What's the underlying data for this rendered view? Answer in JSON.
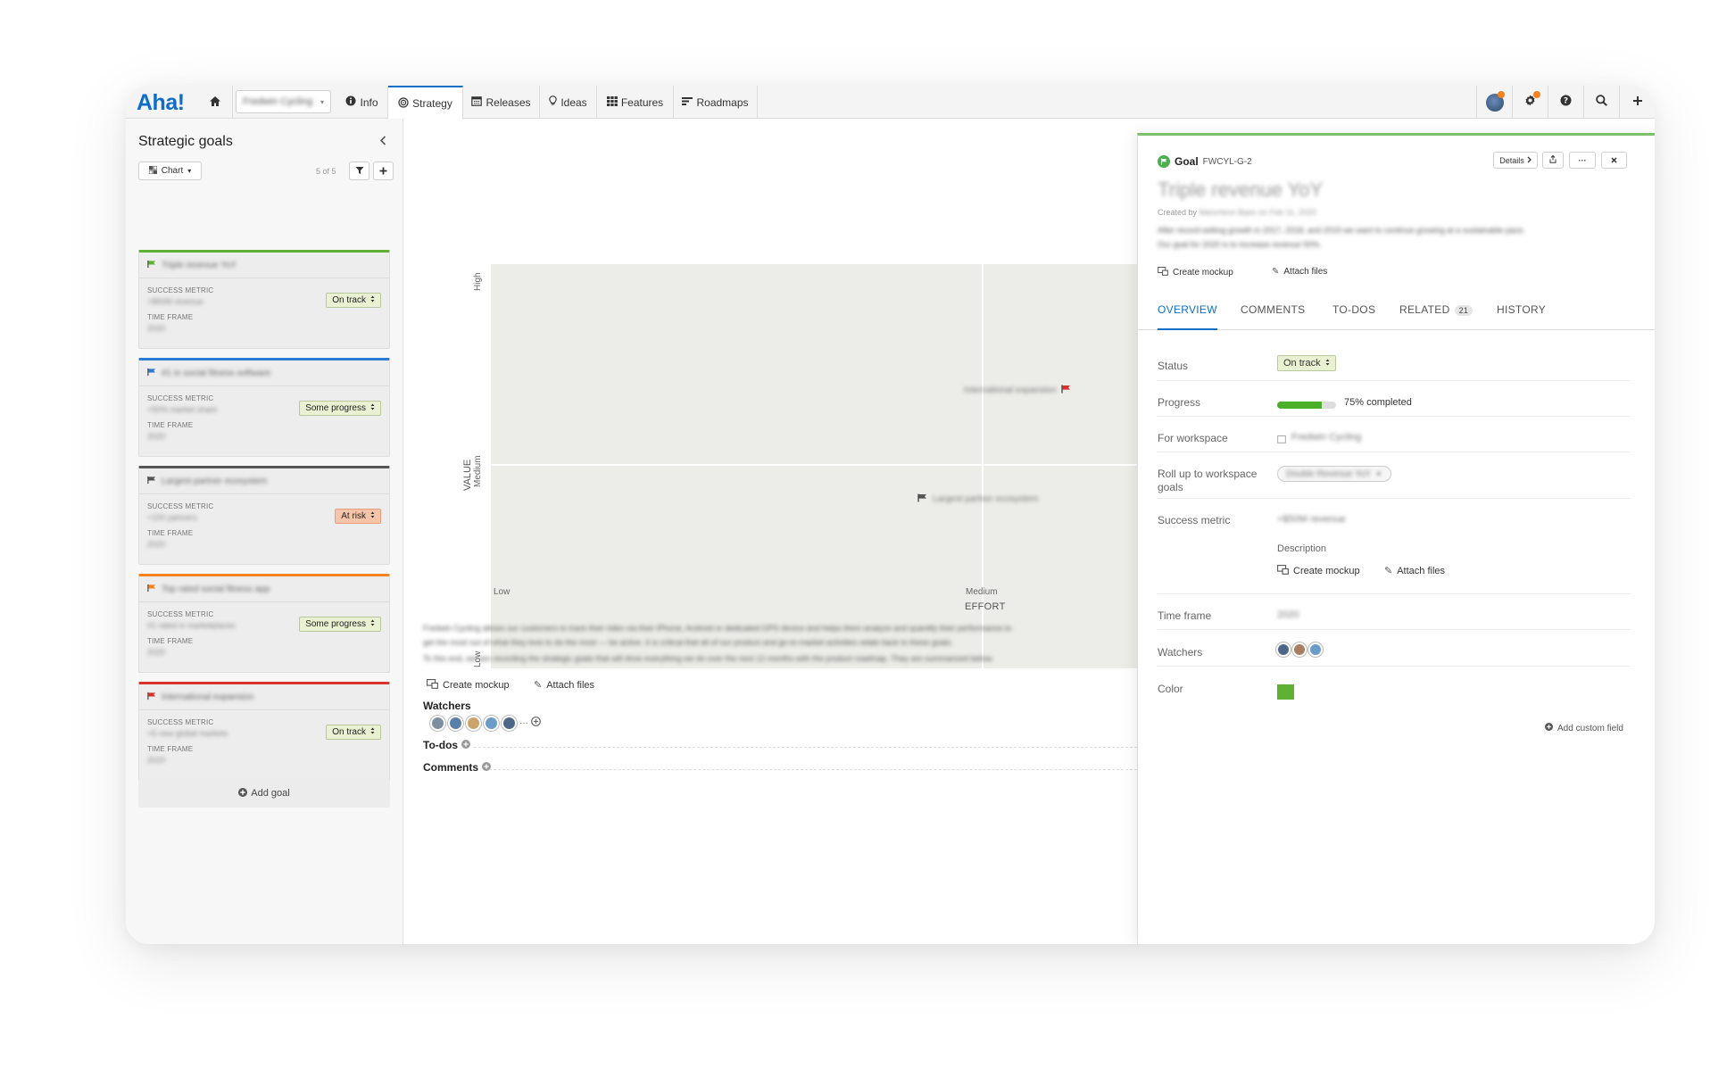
{
  "brand": {
    "logo": "Aha!",
    "accent": "#0d6ec8"
  },
  "nav": {
    "workspace": "Fredwin Cycling",
    "items": [
      {
        "label": "Info",
        "icon": "info-icon"
      },
      {
        "label": "Strategy",
        "icon": "strategy-icon",
        "active": true
      },
      {
        "label": "Releases",
        "icon": "calendar-icon"
      },
      {
        "label": "Ideas",
        "icon": "lightbulb-icon"
      },
      {
        "label": "Features",
        "icon": "grid-icon"
      },
      {
        "label": "Roadmaps",
        "icon": "roadmap-icon"
      }
    ]
  },
  "sidebar": {
    "title": "Strategic goals",
    "view_label": "Chart",
    "count": "5 of 5",
    "success_metric_label": "SUCCESS METRIC",
    "time_frame_label": "TIME FRAME",
    "goals": [
      {
        "title": "Triple revenue YoY",
        "metric": "+$50M revenue",
        "time_frame": "2020",
        "status": "On track",
        "color": "#5fb134"
      },
      {
        "title": "#1 in social fitness software",
        "metric": "+50% market share",
        "time_frame": "2020",
        "status": "Some progress",
        "color": "#2f7ad1"
      },
      {
        "title": "Largest partner ecosystem",
        "metric": "+100 partners",
        "time_frame": "2020",
        "status": "At risk",
        "color": "#555555"
      },
      {
        "title": "Top rated social fitness app",
        "metric": "#1 rated in marketplaces",
        "time_frame": "2020",
        "status": "Some progress",
        "color": "#f5821f"
      },
      {
        "title": "International expansion",
        "metric": "+5 new global markets",
        "time_frame": "2020",
        "status": "On track",
        "color": "#d9312b"
      }
    ],
    "add_goal_label": "Add goal"
  },
  "strategy_chart": {
    "y_axis": {
      "title": "VALUE",
      "high": "High",
      "medium": "Medium",
      "low": "Low"
    },
    "x_axis": {
      "title": "EFFORT",
      "low": "Low",
      "medium": "Medium"
    },
    "marks": [
      {
        "label": "International expansion",
        "flag_color": "#d9312b"
      },
      {
        "label": "Largest partner ecosystem",
        "flag_color": "#555555"
      }
    ]
  },
  "main": {
    "description_lines": [
      "Fredwin Cycling allows our customers to track their rides via their iPhone, Android or dedicated GPS device and helps them analyze and quantify their performance to",
      "get the most out of what they love to do the most — be active. It is critical that all of our product and go-to-market activities relate back to these goals.",
      "To this end, we are recording the strategic goals that will drive everything we do over the next 12 months with the product roadmap. They are summarized below."
    ],
    "create_mockup": "Create mockup",
    "attach_files": "Attach files",
    "watchers_title": "Watchers",
    "todos_title": "To-dos",
    "comments_title": "Comments",
    "more": "···"
  },
  "detail": {
    "record_type": "Goal",
    "ref": "FWCYL-G-2",
    "details_btn": "Details",
    "title": "Triple revenue YoY",
    "created_prefix": "Created by",
    "created_text": "Manchess Baes on Feb 11, 2020",
    "description_lines": [
      "After record-setting growth in 2017, 2018, and 2019 we want to continue growing at a sustainable pace.",
      "Our goal for 2020 is to increase revenue 50%."
    ],
    "create_mockup": "Create mockup",
    "attach_files": "Attach files",
    "tabs": [
      {
        "label": "OVERVIEW",
        "active": true
      },
      {
        "label": "COMMENTS"
      },
      {
        "label": "TO-DOS"
      },
      {
        "label": "RELATED",
        "count": "21"
      },
      {
        "label": "HISTORY"
      }
    ],
    "fields": {
      "status_label": "Status",
      "status_value": "On track",
      "progress_label": "Progress",
      "progress_value": 0.75,
      "progress_text": "75% completed",
      "workspace_label": "For workspace",
      "workspace_value": "Fredwin Cycling",
      "rollup_label": "Roll up to workspace goals",
      "rollup_value": "Double Revenue YoY",
      "metric_label": "Success metric",
      "metric_value": "+$50M revenue",
      "description_label": "Description",
      "time_frame_label": "Time frame",
      "time_frame_value": "2020",
      "watchers_label": "Watchers",
      "color_label": "Color",
      "color_value": "#5fb134"
    },
    "add_custom_field": "Add custom field"
  }
}
